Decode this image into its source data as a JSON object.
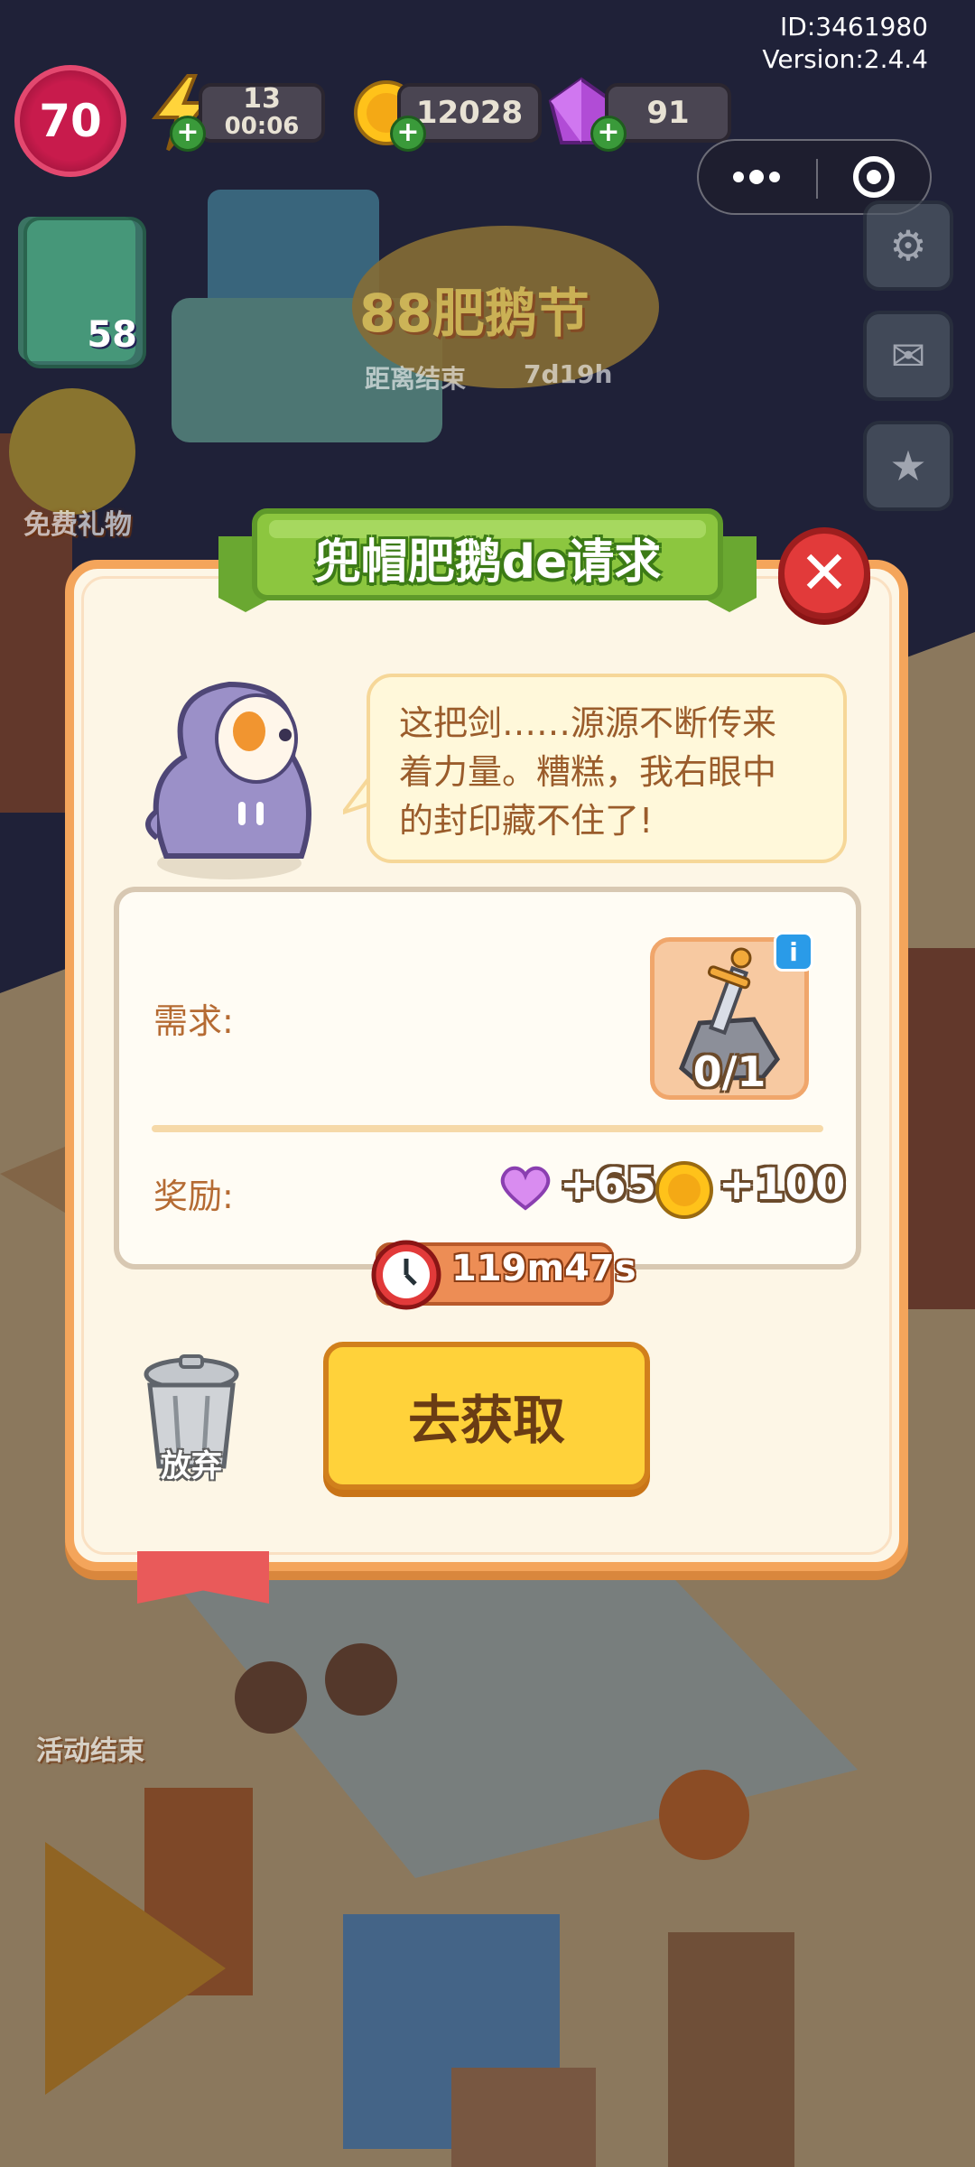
{
  "hud": {
    "id_text": "ID:3461980",
    "version_text": "Version:2.4.4",
    "level": "70",
    "energy": "13",
    "energy_timer": "00:06",
    "coins": "12028",
    "gems": "91",
    "inventory_count": "58"
  },
  "background": {
    "event_title": "88肥鹅节",
    "event_countdown_label": "距离结束",
    "event_countdown_value": "7d19h",
    "free_gift_label": "免费礼物",
    "event_end_label": "活动结束"
  },
  "dialog": {
    "title": "兜帽肥鹅de请求",
    "speech_line1": "这把剑……源源不断传来",
    "speech_line2": "着力量。糟糕，我右眼中",
    "speech_line3": "的封印藏不住了!",
    "requirement_label": "需求:",
    "item_progress": "0/1",
    "reward_label": "奖励:",
    "reward_heart": "+65",
    "reward_coin": "+100",
    "timer": "119m47s",
    "abandon_label": "放弃",
    "get_button": "去获取"
  },
  "colors": {
    "panel_bg": "#fdf6e6",
    "panel_border": "#f4a55b",
    "banner_green": "#8cc63f",
    "close_red": "#e23a3a",
    "button_yellow": "#ffd23a",
    "text_brown": "#b56b33"
  }
}
